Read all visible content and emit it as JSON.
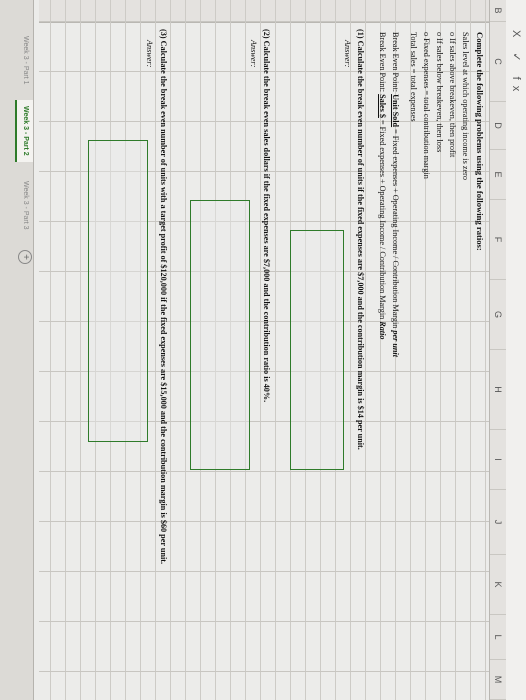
{
  "toolbar": {
    "formula_icons": "X ✓ fx"
  },
  "columns": [
    "B",
    "C",
    "D",
    "E",
    "F",
    "G",
    "H",
    "I",
    "J",
    "K",
    "L",
    "M"
  ],
  "intro": {
    "heading": "Complete the following problems using the following ratios:",
    "line1": "Sales level at which operating income is zero",
    "bullet1": "o   If sales above breakeven, then profit",
    "bullet2": "o   If sales below breakeven, then loss",
    "bullet3": "o   Fixed expenses = total contribution margin",
    "line2": "Total sales = total expenses",
    "bep_units_prefix": "Break Even Point: ",
    "bep_units_key": "Unit Sold",
    "bep_units_rest": " = Fixed expenses + Operating Income / Contribution Margin ",
    "bep_units_suffix": "per unit",
    "bep_sales_prefix": "Break Even Point: ",
    "bep_sales_key": "Sales $",
    "bep_sales_rest": " = Fixed expenses + Operating Income / Contribution Margin ",
    "bep_sales_suffix": "Ratio"
  },
  "questions": [
    {
      "label": "(1)  Calculate the break even number of units if the fixed expenses are $7,000 and the contribution margin is $14 per unit.",
      "answer": "Answer:"
    },
    {
      "label": "(2)  Calculate the break even sales dollars if the fixed expenses are $7,000 and the contribution ratio is 40%.",
      "answer": "Answer:"
    },
    {
      "label": "(3)  Calculate the break even number of units with a target profit of $120,000 if the fixed expenses are $15,000 and the contribution margin is $60 per unit.",
      "answer": "Answer:"
    }
  ],
  "tabs": [
    "Week 3 - Part 1",
    "Week 3 - Part 2",
    "Week 3 - Part 3"
  ],
  "active_tab_index": 1,
  "colors": {
    "accent": "#2f7b2a"
  }
}
